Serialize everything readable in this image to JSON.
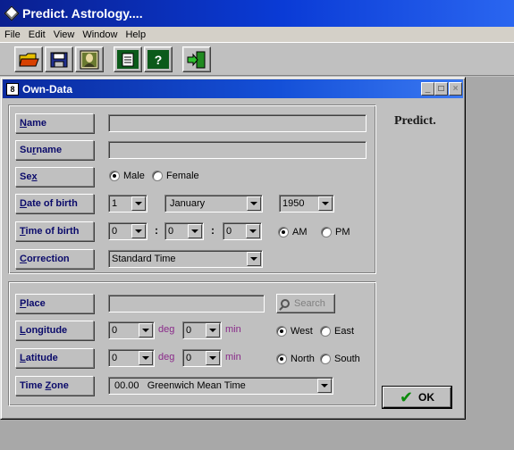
{
  "app": {
    "title": "Predict. Astrology...."
  },
  "menu": [
    "File",
    "Edit",
    "View",
    "Window",
    "Help"
  ],
  "toolbar": {
    "buttons": [
      {
        "name": "open-folder-icon"
      },
      {
        "name": "save-disk-icon"
      },
      {
        "name": "portrait-icon"
      },
      {
        "name": "document-icon"
      },
      {
        "name": "help-icon",
        "glyph": "?"
      },
      {
        "name": "exit-door-icon"
      }
    ]
  },
  "dialog": {
    "title": "Own-Data",
    "logo": "Predict.",
    "fields": {
      "name": "Name",
      "surname": "Surname",
      "sex": "Sex",
      "date_of_birth": "Date of birth",
      "time_of_birth": "Time of birth",
      "correction": "Correction",
      "place": "Place",
      "longitude": "Longitude",
      "latitude": "Latitude",
      "time_zone": "Time Zone"
    },
    "values": {
      "name": "",
      "surname": "",
      "sex_male": "Male",
      "sex_female": "Female",
      "day": "1",
      "month": "January",
      "year": "1950",
      "hour": "0",
      "minute": "0",
      "second": "0",
      "am": "AM",
      "pm": "PM",
      "correction": "Standard Time",
      "place": "",
      "search": "Search",
      "lon_deg": "0",
      "lon_min": "0",
      "west": "West",
      "east": "East",
      "lat_deg": "0",
      "lat_min": "0",
      "north": "North",
      "south": "South",
      "tz_offset": "00.00",
      "tz_name": "Greenwich Mean Time",
      "deg_unit": "deg",
      "min_unit": "min",
      "colon": ":"
    },
    "ok": "OK"
  }
}
